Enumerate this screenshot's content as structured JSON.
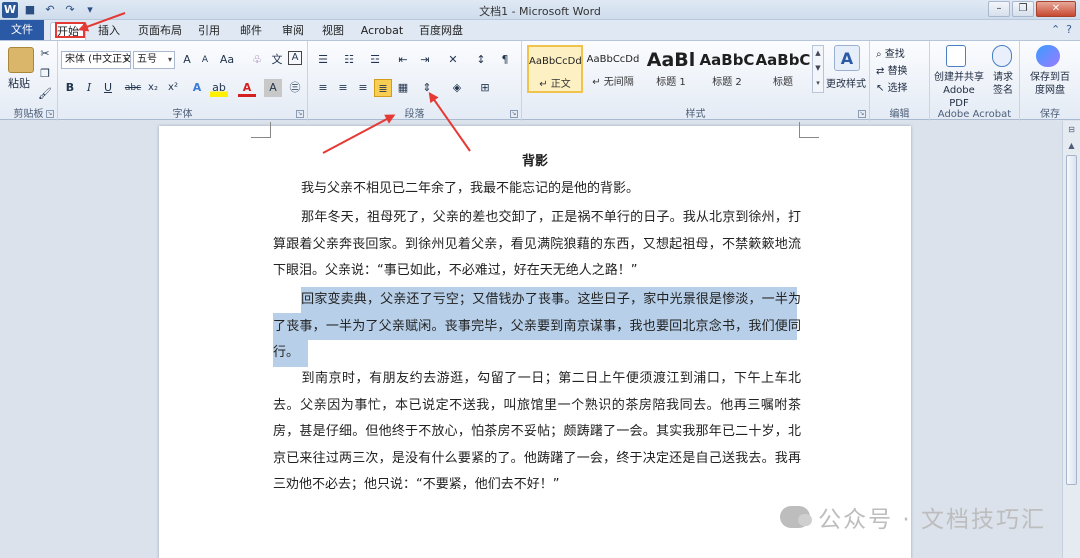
{
  "window": {
    "title": "文档1 - Microsoft Word",
    "app_icon": "W"
  },
  "qat": {
    "icons": [
      "save-icon",
      "undo-icon",
      "redo-icon",
      "customize-icon"
    ]
  },
  "tabs": [
    {
      "label": "文件"
    },
    {
      "label": "开始"
    },
    {
      "label": "插入"
    },
    {
      "label": "页面布局"
    },
    {
      "label": "引用"
    },
    {
      "label": "邮件"
    },
    {
      "label": "审阅"
    },
    {
      "label": "视图"
    },
    {
      "label": "Acrobat"
    },
    {
      "label": "百度网盘"
    }
  ],
  "ribbon": {
    "clipboard": {
      "label": "剪贴板",
      "paste": "粘贴"
    },
    "font": {
      "label": "字体",
      "font_name": "宋体 (中文正文)",
      "font_size": "五号",
      "bold": "B",
      "italic": "I",
      "underline": "U",
      "strike": "abc",
      "sub": "x₂",
      "sup": "x²",
      "aa": "Aa",
      "grow": "A",
      "shrink": "A"
    },
    "paragraph": {
      "label": "段落"
    },
    "styles": {
      "label": "样式",
      "items": [
        {
          "preview": "AaBbCcDd",
          "name": "↵ 正文"
        },
        {
          "preview": "AaBbCcDd",
          "name": "↵ 无间隔"
        },
        {
          "preview": "AaBl",
          "name": "标题 1"
        },
        {
          "preview": "AaBbC",
          "name": "标题 2"
        },
        {
          "preview": "AaBbC",
          "name": "标题"
        }
      ],
      "change_style": "更改样式"
    },
    "editing": {
      "label": "编辑",
      "find": "查找",
      "replace": "替换",
      "select": "选择"
    },
    "acrobat": {
      "label": "Adobe Acrobat",
      "create_pdf": "创建并共享\nAdobe PDF",
      "request_sign": "请求\n签名"
    },
    "save": {
      "label": "保存",
      "save_baidu": "保存到百\n度网盘"
    }
  },
  "document": {
    "title": "背影",
    "paragraphs": [
      "我与父亲不相见已二年余了，我最不能忘记的是他的背影。",
      "那年冬天，祖母死了，父亲的差也交卸了，正是祸不单行的日子。我从北京到徐州，打算跟着父亲奔丧回家。到徐州见着父亲，看见满院狼藉的东西，又想起祖母，不禁簌簌地流下眼泪。父亲说：“事已如此，不必难过，好在天无绝人之路！”",
      "回家变卖典，父亲还了亏空；又借钱办了丧事。这些日子，家中光景很是惨淡，一半为了丧事，一半为了父亲赋闲。丧事完毕，父亲要到南京谋事，我也要回北京念书，我们便同行。",
      "到南京时，有朋友约去游逛，勾留了一日；第二日上午便须渡江到浦口，下午上车北去。父亲因为事忙，本已说定不送我，叫旅馆里一个熟识的茶房陪我同去。他再三嘱咐茶房，甚是仔细。但他终于不放心，怕茶房不妥帖；颇踌躇了一会。其实我那年已二十岁，北京已来往过两三次，是没有什么要紧的了。他踌躇了一会，终于决定还是自己送我去。我再三劝他不必去；他只说：“不要紧，他们去不好！”"
    ]
  },
  "watermark": "公众号 · 文档技巧汇",
  "colors": {
    "file_tab": "#2a5aa5",
    "selection": "#b7cfe8",
    "annotation": "#e53935"
  }
}
